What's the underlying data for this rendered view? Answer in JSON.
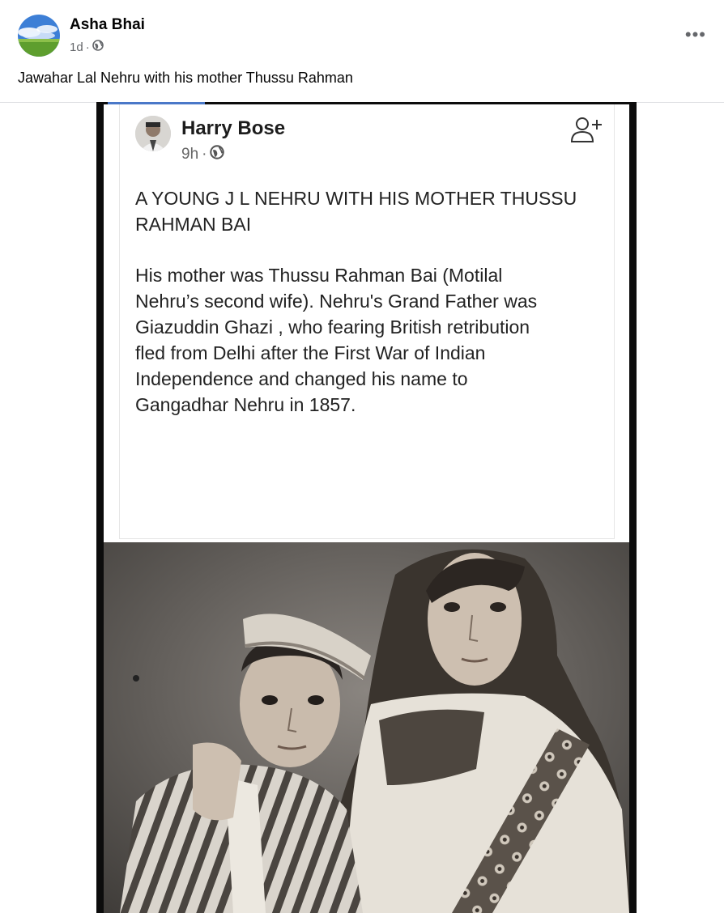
{
  "post": {
    "author": "Asha Bhai",
    "time": "1d",
    "separator": "·",
    "caption": "Jawahar Lal Nehru with his mother Thussu Rahman",
    "more_label": "•••"
  },
  "shared_post": {
    "author": "Harry Bose",
    "time": "9h",
    "separator": "·",
    "headline_line1": "A YOUNG J L NEHRU WITH HIS MOTHER THUSSU",
    "headline_line2": "RAHMAN BAI",
    "body_lines": [
      "His mother was Thussu Rahman Bai (Motilal",
      "Nehru’s second wife). Nehru's Grand Father was",
      "Giazuddin Ghazi , who fearing British retribution",
      "fled from Delhi after the First War of Indian",
      "Independence and changed his name to",
      "Gangadhar Nehru in 1857."
    ]
  },
  "icons": {
    "privacy": "globe-icon",
    "more": "more-options-icon",
    "add_friend": "add-friend-icon"
  },
  "colors": {
    "secondary_text": "#65676b",
    "divider": "#dddfe2",
    "accent": "#4a78c8"
  }
}
